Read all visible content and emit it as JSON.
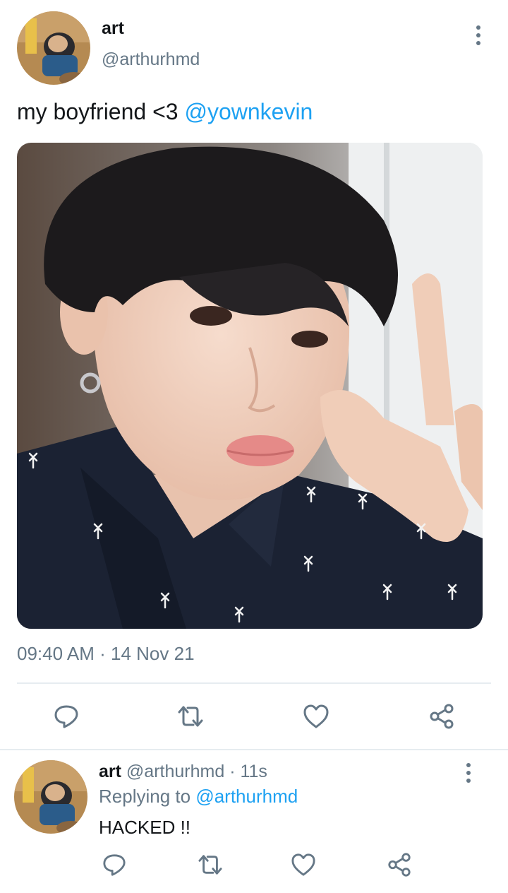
{
  "main_tweet": {
    "author_name": "art",
    "author_handle": "@arthurhmd",
    "text_prefix": "my boyfriend <3 ",
    "mention": "@yownkevin",
    "time": "09:40 AM",
    "separator": "·",
    "date": "14 Nov 21",
    "actions": [
      "reply-icon",
      "retweet-icon",
      "like-icon",
      "share-icon"
    ]
  },
  "reply_tweet": {
    "author_name": "art",
    "author_handle": "@arthurhmd",
    "separator": "·",
    "age": "11s",
    "replying_prefix": "Replying to ",
    "replying_handle": "@arthurhmd",
    "text": "HACKED !!",
    "actions": [
      "reply-icon",
      "retweet-icon",
      "like-icon",
      "share-icon"
    ]
  },
  "colors": {
    "link": "#1da1f2",
    "secondary_text": "#657786",
    "divider": "#e6ecf0",
    "shirt": "#1b2233",
    "hair": "#1c1a1c"
  }
}
